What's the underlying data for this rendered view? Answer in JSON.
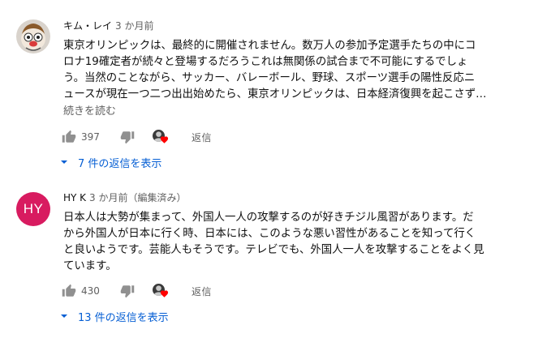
{
  "comments": [
    {
      "author": "キム・レイ",
      "time": "3 か月前",
      "lines": [
        "東京オリンピックは、最終的に開催されません。数万人の参加予定選手たちの中にコ",
        "ロナ19確定者が続々と登場するだろうこれは無関係の試合まで不可能にするでしょ",
        "う。当然のことながら、サッカー、バレーボール、野球、スポーツ選手の陽性反応ニ",
        "ュースが現在一つ二つ出出始めたら、東京オリンピックは、日本経済復興を起こさず…"
      ],
      "read_more": "続きを読む",
      "likes": "397",
      "reply_label": "返信",
      "replies_toggle": "7 件の返信を表示",
      "avatar_icon": "cartoon-avatar-icon"
    },
    {
      "author": "HY K",
      "time": "3 か月前（編集済み）",
      "avatar_initials": "HY",
      "avatar_color": "#d81b60",
      "lines": [
        "日本人は大勢が集まって、外国人一人の攻撃するのが好きチジル風習があります。だ",
        "から外国人が日本に行く時、日本には、このような悪い習性があることを知って行く",
        "と良いようです。芸能人もそうです。テレビでも、外国人一人を攻撃することをよく見",
        "ています。"
      ],
      "likes": "430",
      "reply_label": "返信",
      "replies_toggle": "13 件の返信を表示"
    }
  ],
  "icons": {
    "like": "thumb-up-icon",
    "dislike": "thumb-down-icon",
    "creator_heart": "creator-heart-icon",
    "expand": "caret-down-icon"
  },
  "colors": {
    "link_blue": "#065fd4",
    "heart_red": "#ff0000",
    "secondary_text": "#606060"
  }
}
